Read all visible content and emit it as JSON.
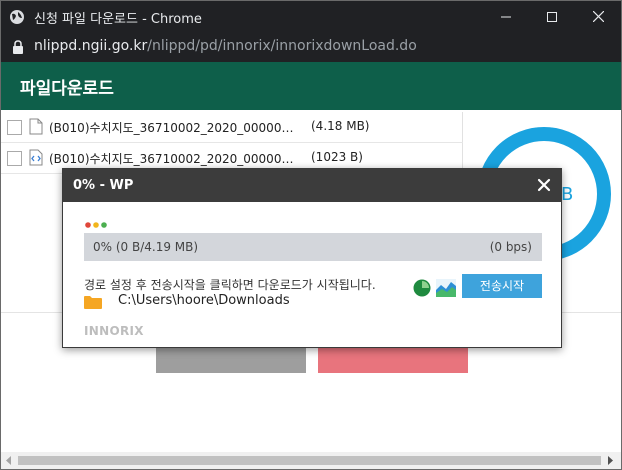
{
  "window": {
    "title": "신청 파일 다운로드 - Chrome",
    "url_host": "nlippd.ngii.go.kr",
    "url_path": "/nlippd/pd/innorix/innorixdownLoad.do"
  },
  "page": {
    "header_title": "파일다운로드",
    "files": [
      {
        "name": "(B010)수치지도_36710002_2020_00000000000000",
        "size": "(4.18 MB)"
      },
      {
        "name": "(B010)수치지도_36710002_2020_00000000000000",
        "size": "(1023 B)"
      }
    ],
    "summary_unit": "B"
  },
  "modal": {
    "title": "0% - WP",
    "progress_fraction": 0,
    "progress_text": "0% (0 B/4.19 MB)",
    "speed_text": "(0 bps)",
    "message": "경로 설정 후 전송시작을 클릭하면 다운로드가 시작됩니다.",
    "path": "C:\\Users\\hoore\\Downloads",
    "start_button": "전송시작",
    "brand": "INNORIX"
  },
  "icons": {
    "globe": "globe-icon",
    "lock": "lock-icon",
    "folder": "folder-icon",
    "clock": "clock-icon",
    "chart": "chart-icon",
    "close": "close-icon"
  },
  "colors": {
    "header": "#0e5f4a",
    "accent": "#3ea3dc",
    "ring": "#1aa3df",
    "red_button": "#e8747d",
    "grey_button": "#9e9e9e"
  }
}
